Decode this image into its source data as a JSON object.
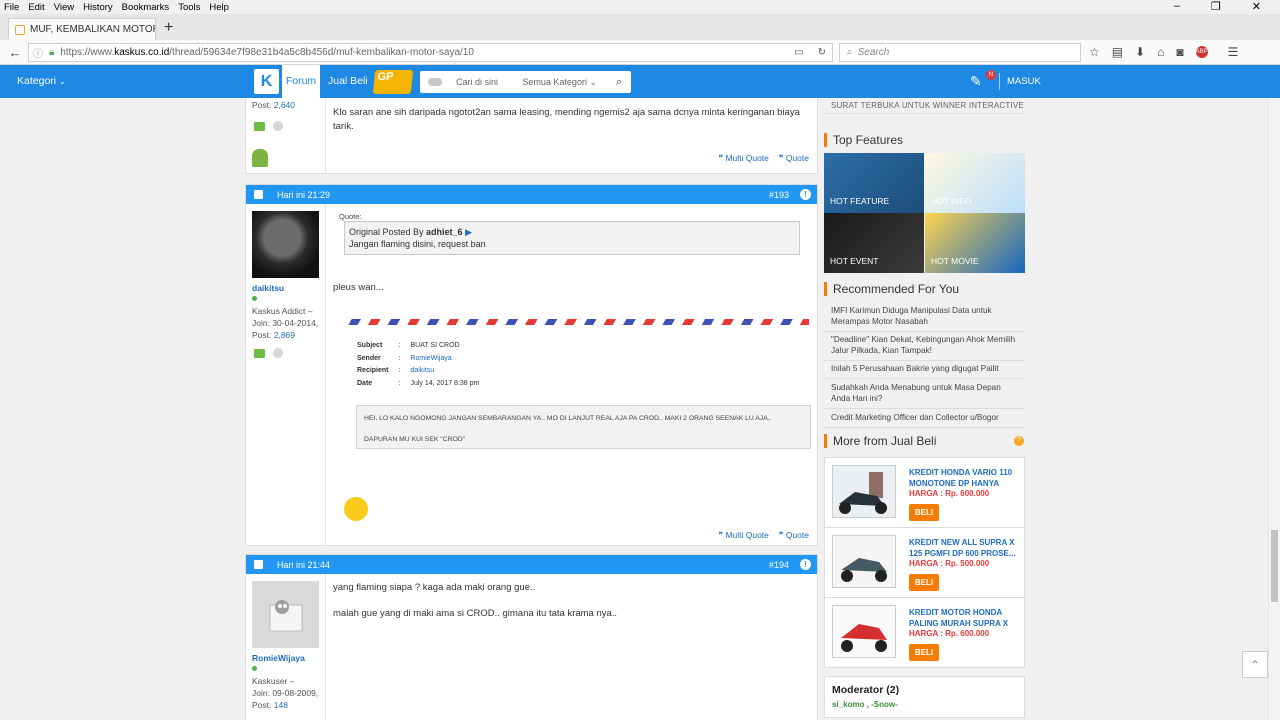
{
  "browser": {
    "menu": [
      "File",
      "Edit",
      "View",
      "History",
      "Bookmarks",
      "Tools",
      "Help"
    ],
    "tab_title": "MUF, KEMBALIKAN MOTOR",
    "url_prefix": "https://www.",
    "url_domain": "kaskus.co.id",
    "url_path": "/thread/59634e7f98e31b4a5c8b456d/muf-kembalikan-motor-saya/10",
    "search_placeholder": "Search"
  },
  "header": {
    "kategori": "Kategori",
    "logo": "K",
    "forum": "Forum",
    "jual_beli": "Jual Beli",
    "gp": "GP",
    "search_placeholder": "Cari di sini",
    "search_category": "Semua Kategori",
    "notif_count": "N",
    "masuk": "MASUK"
  },
  "posts": {
    "p0": {
      "post_label": "Post: ",
      "post_count": "2,640",
      "text": "Klo saran ane sih daripada ngotot2an sama leasing, mending ngemis2 aja sama dcnya minta keringanan biaya tarik.",
      "multi_quote": "Multi Quote",
      "quote": "Quote"
    },
    "p193": {
      "time": "Hari ini 21:29",
      "number": "#193",
      "username": "daikitsu",
      "rank": "Kaskus Addict –",
      "join": "Join: 30-04-2014,",
      "post_label": "Post: ",
      "post_count": "2,869",
      "quote_label": "Quote:",
      "quote_head": "Original Posted By ",
      "quote_author": "adhiet_6",
      "quote_text": "Jangan flaming disini, request ban",
      "text": "pleus wan...",
      "mail": {
        "subject_k": "Subject",
        "subject_v": "BUAT SI CROD",
        "sender_k": "Sender",
        "sender_v": "RomieWijaya",
        "recipient_k": "Recipient",
        "recipient_v": "daikitsu",
        "date_k": "Date",
        "date_v": "July 14, 2017 8:38 pm",
        "message_1": "HEI, LO KALO NGOMONG JANGAN SEMBARANGAN YA.. MO DI LANJUT REAL AJA PA CROD.. MAKI 2 ORANG SEENAK LU AJA..",
        "message_2": "DAPURAN MU KUI SEK \"CROD\""
      },
      "multi_quote": "Multi Quote",
      "quote": "Quote"
    },
    "p194": {
      "time": "Hari ini 21:44",
      "number": "#194",
      "username": "RomieWijaya",
      "rank": "Kaskuser –",
      "join": "Join: 09-08-2009,",
      "post_label": "Post: ",
      "post_count": "148",
      "text_1": "yang flaming siapa ? kaga ada maki orang gue..",
      "text_2": "malah gue yang di maki ama si CROD.. gimana itu tata krama nya.."
    }
  },
  "sidebar": {
    "top_link": "SURAT TERBUKA UNTUK WINNER INTERACTIVE",
    "top_features_title": "Top Features",
    "features": [
      "HOT FEATURE",
      "HOT INFO",
      "HOT EVENT",
      "HOT MOVIE"
    ],
    "recommended_title": "Recommended For You",
    "recommended": [
      "IMFI Karimun Diduga Manipulasi Data untuk Merampas Motor Nasabah",
      "\"Deadline\" Kian Dekat, Kebingungan Ahok Memilih Jalur Pilkada, Kian Tampak!",
      "Inilah 5 Perusahaan Bakrie yang digugat Pailit",
      "Sudahkah Anda Menabung untuk Masa Depan Anda Hari ini?",
      "Credit Marketing Officer dan Collector u/Bogor"
    ],
    "jualbeli_title": "More from Jual Beli",
    "listings": [
      {
        "title": "KREDIT HONDA VARIO 110 MONOTONE DP HANYA",
        "price": "HARGA : Rp. 600.000",
        "button": "BELI"
      },
      {
        "title": "KREDIT NEW ALL SUPRA X 125 PGMFI DP 600 PROSE...",
        "price": "HARGA : Rp. 500.000",
        "button": "BELI"
      },
      {
        "title": "KREDIT MOTOR HONDA PALING MURAH SUPRA X",
        "price": "HARGA : Rp. 600.000",
        "button": "BELI"
      }
    ],
    "moderator_title": "Moderator (2)",
    "moderators": "si_komo , -Snow-"
  },
  "colors": {
    "brand": "#1e88e5",
    "accent": "#f57c00"
  }
}
